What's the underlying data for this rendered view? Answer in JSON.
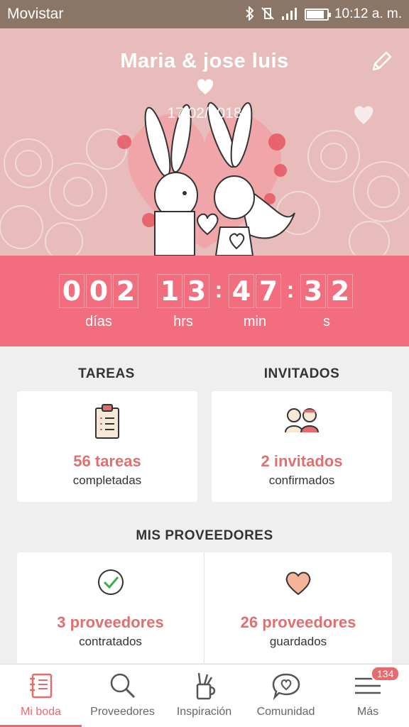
{
  "status_bar": {
    "carrier": "Movistar",
    "time": "10:12 a. m.",
    "battery_level": 0.85,
    "icons": [
      "bluetooth-icon",
      "vibrate-icon",
      "signal-icon",
      "battery-icon"
    ]
  },
  "hero": {
    "title": "Maria & jose luis",
    "date": "17/02/2018",
    "icons": [
      "heart-icon",
      "pencil-icon"
    ],
    "colors": {
      "background": "#e7bcba",
      "accent": "#f26d7d"
    }
  },
  "countdown": {
    "days_digits": [
      "0",
      "0",
      "2"
    ],
    "hours_digits": [
      "1",
      "3"
    ],
    "minutes_digits": [
      "4",
      "7"
    ],
    "seconds_digits": [
      "3",
      "2"
    ],
    "separator": ":",
    "labels": {
      "days": "días",
      "hours": "hrs",
      "minutes": "min",
      "seconds": "s"
    }
  },
  "tareas": {
    "title": "TAREAS",
    "main": "56 tareas",
    "sub": "completadas",
    "icon": "clipboard-icon"
  },
  "invitados": {
    "title": "INVITADOS",
    "main": "2 invitados",
    "sub": "confirmados",
    "icon": "guests-icon"
  },
  "proveedores": {
    "title": "MIS PROVEEDORES",
    "contratados": {
      "main": "3 proveedores",
      "sub": "contratados",
      "icon": "check-circle-icon"
    },
    "guardados": {
      "main": "26 proveedores",
      "sub": "guardados",
      "icon": "heart-icon"
    }
  },
  "bottom_nav": {
    "items": [
      {
        "label": "Mi boda",
        "icon": "notebook-icon",
        "active": true
      },
      {
        "label": "Proveedores",
        "icon": "search-icon",
        "active": false
      },
      {
        "label": "Inspiración",
        "icon": "brush-cup-icon",
        "active": false
      },
      {
        "label": "Comunidad",
        "icon": "chat-heart-icon",
        "active": false
      },
      {
        "label": "Más",
        "icon": "menu-icon",
        "active": false
      }
    ],
    "badge": "134"
  }
}
